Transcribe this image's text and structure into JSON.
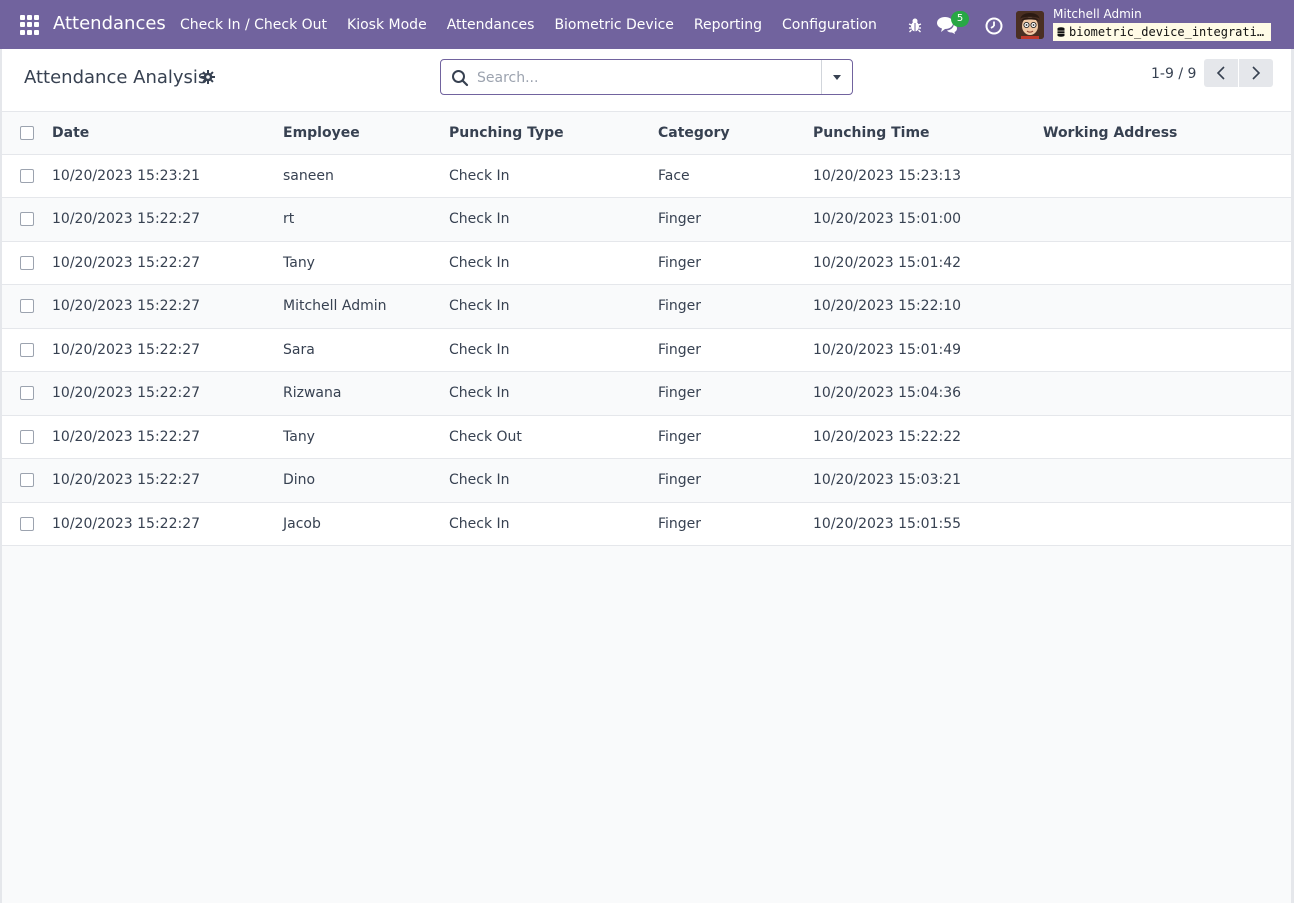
{
  "navbar": {
    "app_title": "Attendances",
    "menu": [
      {
        "label": "Check In / Check Out"
      },
      {
        "label": "Kiosk Mode"
      },
      {
        "label": "Attendances"
      },
      {
        "label": "Biometric Device"
      },
      {
        "label": "Reporting"
      },
      {
        "label": "Configuration"
      }
    ],
    "chat_count": "5",
    "user_name": "Mitchell Admin",
    "database": "biometric_device_integration",
    "accent_color": "#71639e"
  },
  "control_panel": {
    "title": "Attendance Analysis",
    "search_placeholder": "Search...",
    "pager": "1-9 / 9"
  },
  "table": {
    "columns": [
      "Date",
      "Employee",
      "Punching Type",
      "Category",
      "Punching Time",
      "Working Address"
    ],
    "rows": [
      {
        "date": "10/20/2023 15:23:21",
        "employee": "saneen",
        "punching_type": "Check In",
        "category": "Face",
        "punching_time": "10/20/2023 15:23:13",
        "working_address": ""
      },
      {
        "date": "10/20/2023 15:22:27",
        "employee": "rt",
        "punching_type": "Check In",
        "category": "Finger",
        "punching_time": "10/20/2023 15:01:00",
        "working_address": ""
      },
      {
        "date": "10/20/2023 15:22:27",
        "employee": "Tany",
        "punching_type": "Check In",
        "category": "Finger",
        "punching_time": "10/20/2023 15:01:42",
        "working_address": ""
      },
      {
        "date": "10/20/2023 15:22:27",
        "employee": "Mitchell Admin",
        "punching_type": "Check In",
        "category": "Finger",
        "punching_time": "10/20/2023 15:22:10",
        "working_address": ""
      },
      {
        "date": "10/20/2023 15:22:27",
        "employee": "Sara",
        "punching_type": "Check In",
        "category": "Finger",
        "punching_time": "10/20/2023 15:01:49",
        "working_address": ""
      },
      {
        "date": "10/20/2023 15:22:27",
        "employee": "Rizwana",
        "punching_type": "Check In",
        "category": "Finger",
        "punching_time": "10/20/2023 15:04:36",
        "working_address": ""
      },
      {
        "date": "10/20/2023 15:22:27",
        "employee": "Tany",
        "punching_type": "Check Out",
        "category": "Finger",
        "punching_time": "10/20/2023 15:22:22",
        "working_address": ""
      },
      {
        "date": "10/20/2023 15:22:27",
        "employee": "Dino",
        "punching_type": "Check In",
        "category": "Finger",
        "punching_time": "10/20/2023 15:03:21",
        "working_address": ""
      },
      {
        "date": "10/20/2023 15:22:27",
        "employee": "Jacob",
        "punching_type": "Check In",
        "category": "Finger",
        "punching_time": "10/20/2023 15:01:55",
        "working_address": ""
      }
    ]
  }
}
